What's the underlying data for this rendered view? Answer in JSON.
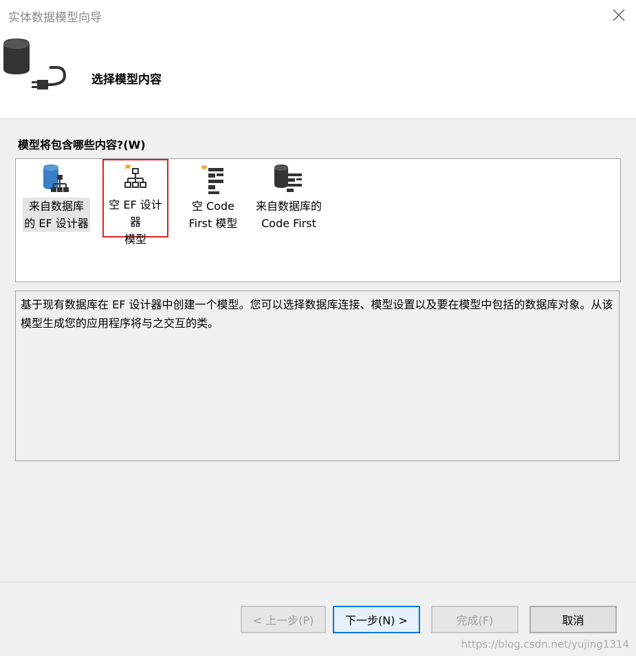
{
  "window": {
    "title": "实体数据模型向导"
  },
  "header": {
    "title": "选择模型内容"
  },
  "question": "模型将包含哪些内容?(W)",
  "choices": [
    {
      "label": "来自数据库\n的 EF 设计器",
      "icon": "database-hierarchy-icon"
    },
    {
      "label": "空 EF 设计器\n模型",
      "icon": "empty-designer-icon"
    },
    {
      "label": "空 Code\nFirst 模型",
      "icon": "empty-code-first-icon"
    },
    {
      "label": "来自数据库的\nCode First",
      "icon": "database-code-first-icon"
    }
  ],
  "selected_choice": 1,
  "description": "基于现有数据库在 EF 设计器中创建一个模型。您可以选择数据库连接、模型设置以及要在模型中包括的数据库对象。从该模型生成您的应用程序将与之交互的类。",
  "buttons": {
    "prev": "< 上一步(P)",
    "next": "下一步(N) >",
    "finish": "完成(F)",
    "cancel": "取消"
  },
  "watermark": "https://blog.csdn.net/yujing1314",
  "colors": {
    "selection_border": "#e02020",
    "primary_border": "#0078d7",
    "icon_dark": "#404040",
    "icon_blue": "#3a7fc4",
    "icon_spark": "#f0a020"
  }
}
